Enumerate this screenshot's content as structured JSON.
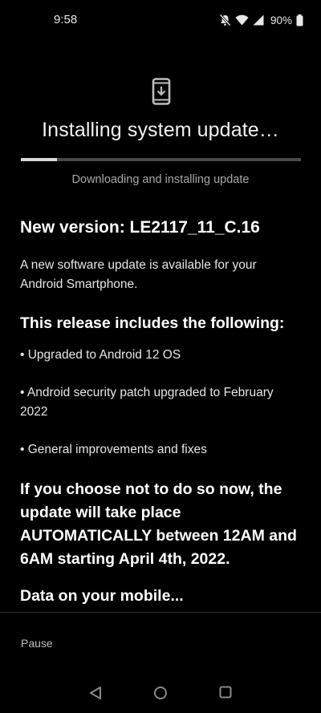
{
  "status_bar": {
    "time": "9:58",
    "battery": "90%",
    "icons": [
      "bell-muted-icon",
      "wifi-icon",
      "cell-signal-icon",
      "battery-icon"
    ]
  },
  "header": {
    "icon": "phone-download-icon",
    "title": "Installing system update…",
    "progress": 0.13,
    "status": "Downloading and installing update"
  },
  "content": {
    "version_heading": "New version: LE2117_11_C.16",
    "intro": "A new software update is available for your Android Smartphone.",
    "release_heading": "This release includes the following:",
    "bullets": [
      "• Upgraded to Android 12 OS",
      "• Android security patch upgraded to February 2022",
      "• General improvements and fixes"
    ],
    "notice": "If you choose not to do so now, the update will take place AUTOMATICALLY between 12AM and 6AM starting April 4th, 2022.",
    "cut_off_text": "Data on your mobile..."
  },
  "footer": {
    "pause_label": "Pause"
  },
  "nav": {
    "buttons": [
      "back-icon",
      "home-icon",
      "recents-icon"
    ]
  },
  "colors": {
    "background": "#000000",
    "progress_fill": "#d9d9d9",
    "progress_track": "#4a4a4a",
    "secondary_text": "#a8a8a8"
  }
}
